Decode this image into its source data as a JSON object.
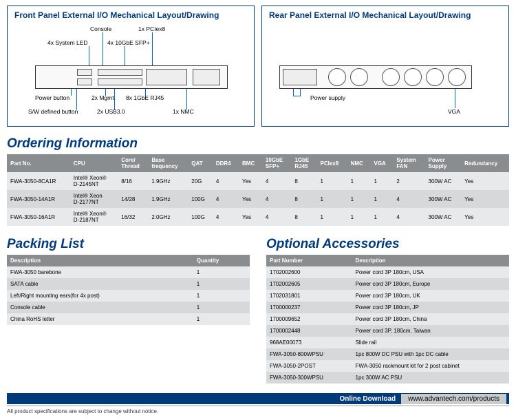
{
  "front_panel": {
    "title": "Front Panel External I/O Mechanical Layout/Drawing",
    "labels": {
      "console": "Console",
      "pciex8": "1x PCIex8",
      "sys_led": "4x System LED",
      "sfp": "4x 10GbE SFP+",
      "power_btn": "Power button",
      "mgmt": "2x Mgmt.",
      "rj45": "8x 1GbE RJ45",
      "sw_btn": "S/W defined button",
      "usb": "2x USB3.0",
      "nmc": "1x NMC"
    }
  },
  "rear_panel": {
    "title": "Rear Panel External I/O Mechanical Layout/Drawing",
    "labels": {
      "psu": "Power supply",
      "vga": "VGA"
    }
  },
  "ordering": {
    "title": "Ordering Information",
    "headers": [
      "Part No.",
      "CPU",
      "Core/\nThread",
      "Base\nfrequency",
      "QAT",
      "DDR4",
      "BMC",
      "10GbE\nSFP+",
      "1GbE\nRJ45",
      "PCIex8",
      "NMC",
      "VGA",
      "System\nFAN",
      "Power\nSupply",
      "Redundancy"
    ],
    "rows": [
      [
        "FWA-3050-8CA1R",
        "Intel® Xeon®\nD-2145NT",
        "8/16",
        "1.9GHz",
        "20G",
        "4",
        "Yes",
        "4",
        "8",
        "1",
        "1",
        "1",
        "2",
        "300W AC",
        "Yes"
      ],
      [
        "FWA-3050-14A1R",
        "Intel® Xeon\nD-2177NT",
        "14/28",
        "1.9GHz",
        "100G",
        "4",
        "Yes",
        "4",
        "8",
        "1",
        "1",
        "1",
        "4",
        "300W AC",
        "Yes"
      ],
      [
        "FWA-3050-16A1R",
        "Intel® Xeon®\nD-2187NT",
        "16/32",
        "2.0GHz",
        "100G",
        "4",
        "Yes",
        "4",
        "8",
        "1",
        "1",
        "1",
        "4",
        "300W AC",
        "Yes"
      ]
    ]
  },
  "packing": {
    "title": "Packing List",
    "headers": [
      "Description",
      "Quantity"
    ],
    "rows": [
      [
        "FWA-3050 barebone",
        "1"
      ],
      [
        "SATA cable",
        "1"
      ],
      [
        "Left/Right mounting ears(for 4x post)",
        "1"
      ],
      [
        "Console cable",
        "1"
      ],
      [
        "China RoHS letter",
        "1"
      ]
    ]
  },
  "accessories": {
    "title": "Optional Accessories",
    "headers": [
      "Part Number",
      "Description"
    ],
    "rows": [
      [
        "1702002600",
        "Power cord 3P 180cm, USA"
      ],
      [
        "1702002605",
        "Power cord 3P 180cm, Europe"
      ],
      [
        "1702031801",
        "Power cord 3P 180cm, UK"
      ],
      [
        "1700000237",
        "Power cord 3P 180cm, JP"
      ],
      [
        "1700009652",
        "Power cord 3P 180cm, China"
      ],
      [
        "1700002448",
        "Power cord 3P, 180cm, Taiwan"
      ],
      [
        "968AE00073",
        "Slide rail"
      ],
      [
        "FWA-3050-800WPSU",
        "1pc 800W DC PSU with 1pc DC cable"
      ],
      [
        "FWA-3050-2POST",
        "FWA-3050 rackmount kit for 2 post cabinet"
      ],
      [
        "FWA-3050-300WPSU",
        "1pc 300W AC PSU"
      ]
    ]
  },
  "footer": {
    "download_label": "Online Download",
    "download_url": "www.advantech.com/products",
    "disclaimer": "All product specifications are subject to change without notice."
  }
}
